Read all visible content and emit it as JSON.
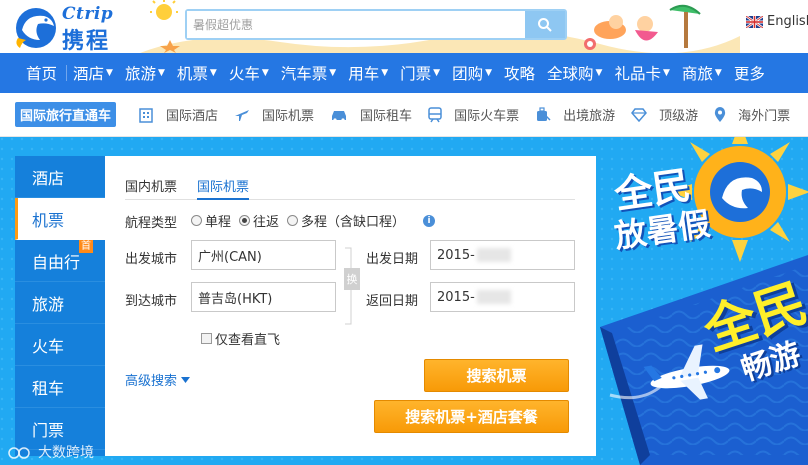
{
  "header": {
    "logo_latin": "Ctrip",
    "logo_cn": "携程",
    "search_placeholder": "暑假超优惠",
    "language": "English"
  },
  "main_nav": [
    {
      "label": "首页",
      "caret": false
    },
    {
      "label": "酒店",
      "caret": true
    },
    {
      "label": "旅游",
      "caret": true
    },
    {
      "label": "机票",
      "caret": true
    },
    {
      "label": "火车",
      "caret": true
    },
    {
      "label": "汽车票",
      "caret": true
    },
    {
      "label": "用车",
      "caret": true
    },
    {
      "label": "门票",
      "caret": true
    },
    {
      "label": "团购",
      "caret": true
    },
    {
      "label": "攻略",
      "caret": false
    },
    {
      "label": "全球购",
      "caret": true
    },
    {
      "label": "礼品卡",
      "caret": true
    },
    {
      "label": "商旅",
      "caret": true
    },
    {
      "label": "更多",
      "caret": false
    }
  ],
  "sub_nav": {
    "title": "国际旅行直通车",
    "items": [
      {
        "label": "国际酒店",
        "icon": "building-icon"
      },
      {
        "label": "国际机票",
        "icon": "plane-icon"
      },
      {
        "label": "国际租车",
        "icon": "car-icon"
      },
      {
        "label": "国际火车票",
        "icon": "train-icon"
      },
      {
        "label": "出境旅游",
        "icon": "luggage-icon"
      },
      {
        "label": "顶级游",
        "icon": "diamond-icon"
      },
      {
        "label": "海外门票",
        "icon": "location-pin-icon"
      }
    ]
  },
  "side_tabs": [
    {
      "label": "酒店",
      "active": false
    },
    {
      "label": "机票",
      "active": true
    },
    {
      "label": "自由行",
      "active": false,
      "badge": "首"
    },
    {
      "label": "旅游",
      "active": false
    },
    {
      "label": "火车",
      "active": false
    },
    {
      "label": "租车",
      "active": false
    },
    {
      "label": "门票",
      "active": false
    }
  ],
  "flight": {
    "tabs": [
      "国内机票",
      "国际机票"
    ],
    "active_tab": "国际机票",
    "trip_type_label": "航程类型",
    "trip_types": [
      "单程",
      "往返",
      "多程（含缺口程）"
    ],
    "selected_trip_type": "往返",
    "depart_city_label": "出发城市",
    "depart_city": "广州(CAN)",
    "arrive_city_label": "到达城市",
    "arrive_city": "普吉岛(HKT)",
    "depart_date_label": "出发日期",
    "depart_date": "2015-",
    "return_date_label": "返回日期",
    "return_date": "2015-",
    "swap_label": "换",
    "direct_only_label": "仅查看直飞",
    "advanced_search": "高级搜索",
    "search_button": "搜索机票",
    "search_hotel_button": "搜索机票+酒店套餐"
  },
  "banner": {
    "text_1": "全民",
    "text_2": "放暑假",
    "text_3": "全民",
    "text_4": "畅游"
  },
  "watermark": "大数跨境",
  "colors": {
    "nav_blue": "#2577e3",
    "side_blue": "#1580db",
    "banner_blue": "#21a9f2",
    "accent_orange": "#f89a07",
    "link_blue": "#1a72d0"
  }
}
